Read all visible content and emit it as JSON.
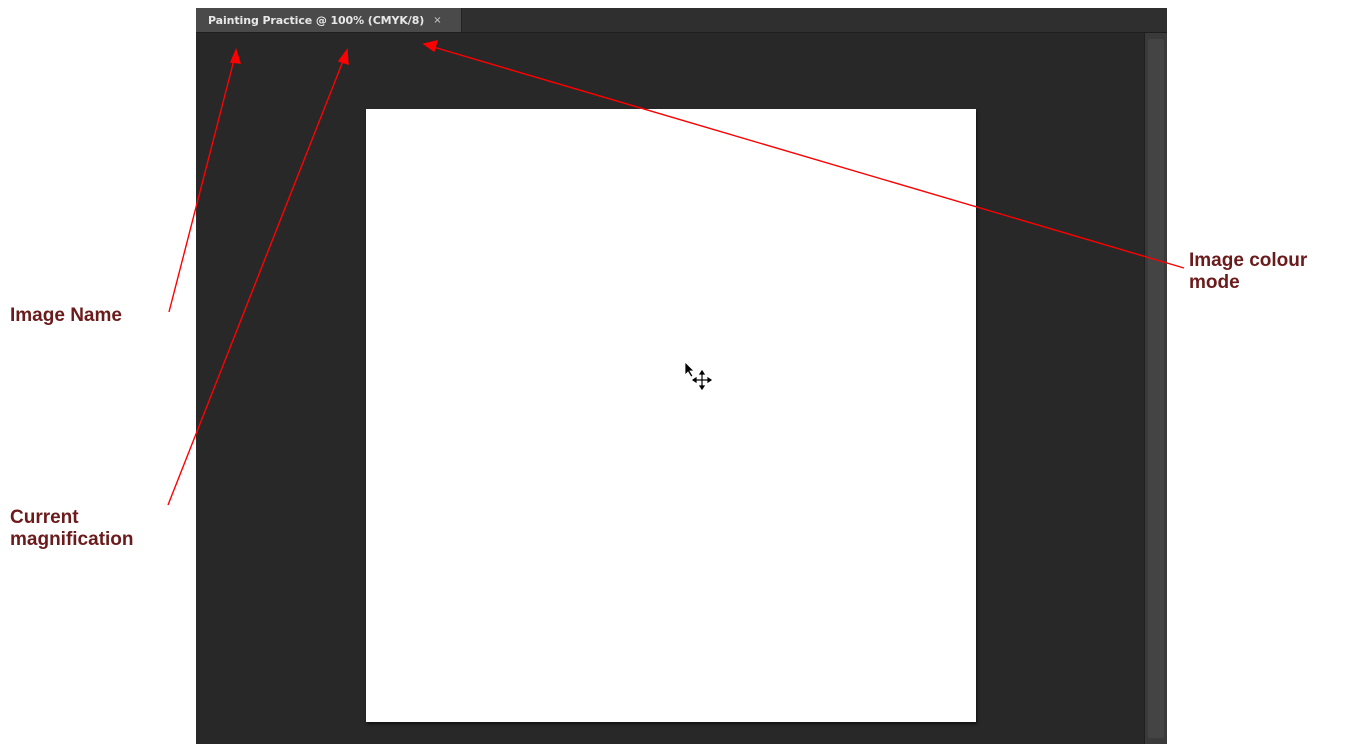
{
  "document": {
    "tab_title": "Painting Practice @ 100% (CMYK/8)",
    "close_glyph": "×",
    "canvas_color": "#ffffff",
    "workspace_color": "#282828"
  },
  "annotations": {
    "image_name": "Image Name",
    "current_magnification": "Current magnification",
    "image_colour_mode": "Image colour mode",
    "label_color": "#6b1b1b",
    "arrow_color": "#ff0000"
  },
  "icons": {
    "cursor": "move-tool-cursor-icon"
  }
}
